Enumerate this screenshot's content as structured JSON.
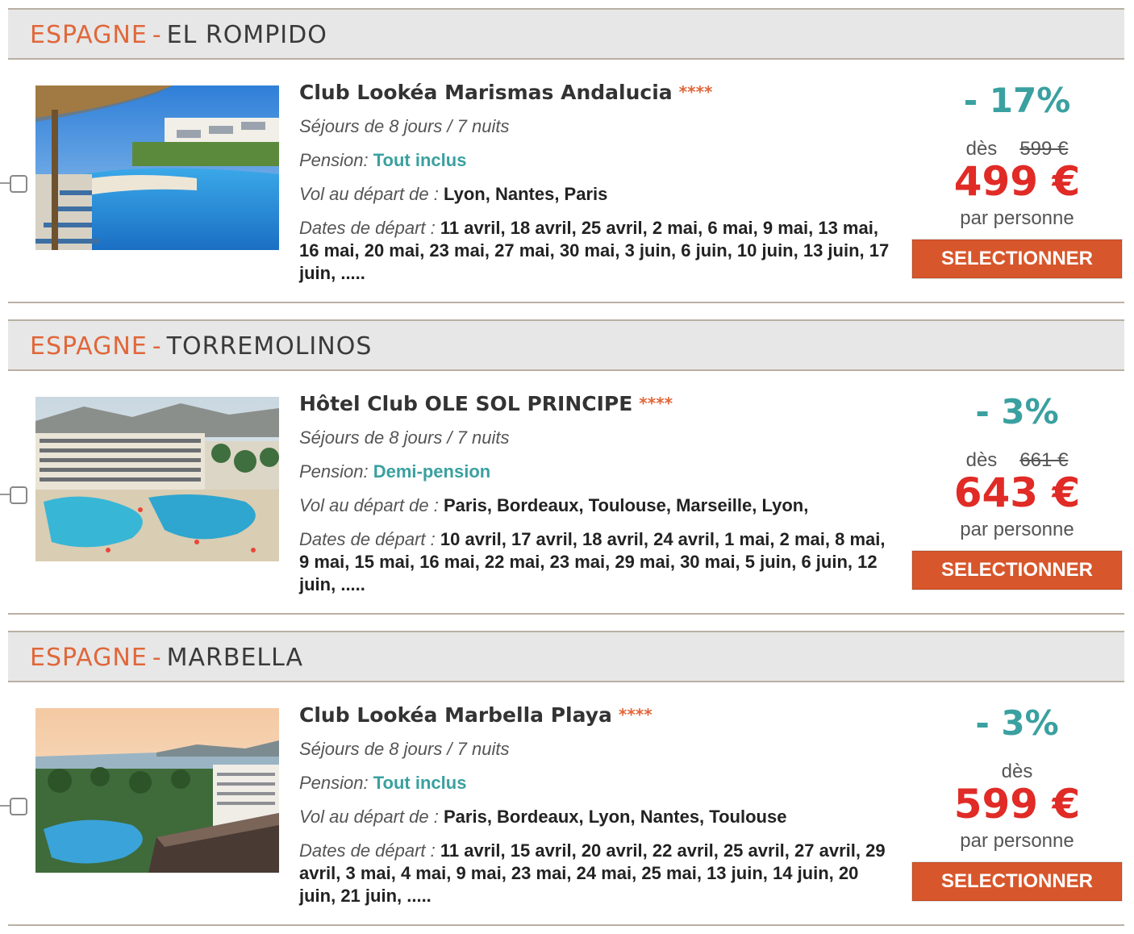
{
  "colors": {
    "accent": "#e0673a",
    "teal": "#3aa0a0",
    "price_red": "#e02b26",
    "button": "#d8562b"
  },
  "listings": [
    {
      "country": "ESPAGNE",
      "separator": "-",
      "city": "EL ROMPIDO",
      "hotel": "Club Lookéa Marismas Andalucia",
      "stars": "****",
      "stay": "Séjours de 8 jours / 7 nuits",
      "pension_label": "Pension:",
      "pension": "Tout inclus",
      "flight_label": "Vol au départ de :",
      "flights": "Lyon, Nantes, Paris",
      "dates_label": "Dates de départ :",
      "dates": "11 avril, 18 avril, 25 avril, 2 mai, 6 mai, 9 mai, 13 mai, 16 mai, 20 mai, 23 mai, 27 mai, 30 mai, 3 juin, 6 juin, 10 juin, 13 juin, 17 juin, .....",
      "discount": "- 17%",
      "from_label": "dès",
      "old_price": "599 €",
      "price": "499 €",
      "per_person": "par personne",
      "button": "SELECTIONNER",
      "image": "pool-resort-umbrella"
    },
    {
      "country": "ESPAGNE",
      "separator": "-",
      "city": "TORREMOLINOS",
      "hotel": "Hôtel Club OLE SOL PRINCIPE",
      "stars": "****",
      "stay": "Séjours de 8 jours / 7 nuits",
      "pension_label": "Pension:",
      "pension": "Demi-pension",
      "flight_label": "Vol au départ de :",
      "flights": "Paris, Bordeaux, Toulouse, Marseille, Lyon,",
      "dates_label": "Dates de départ :",
      "dates": "10 avril, 17 avril, 18 avril, 24 avril, 1 mai, 2 mai, 8 mai, 9 mai, 15 mai, 16 mai, 22 mai, 23 mai, 29 mai, 30 mai, 5 juin, 6 juin, 12 juin, .....",
      "discount": "- 3%",
      "from_label": "dès",
      "old_price": "661 €",
      "price": "643 €",
      "per_person": "par personne",
      "button": "SELECTIONNER",
      "image": "hotel-building-pools"
    },
    {
      "country": "ESPAGNE",
      "separator": "-",
      "city": "MARBELLA",
      "hotel": "Club Lookéa Marbella Playa",
      "stars": "****",
      "stay": "Séjours de 8 jours / 7 nuits",
      "pension_label": "Pension:",
      "pension": "Tout inclus",
      "flight_label": "Vol au départ de :",
      "flights": "Paris, Bordeaux, Lyon, Nantes, Toulouse",
      "dates_label": "Dates de départ :",
      "dates": "11 avril, 15 avril, 20 avril, 22 avril, 25 avril, 27 avril, 29 avril, 3 mai, 4 mai, 9 mai, 23 mai, 24 mai, 25 mai, 13 juin, 14 juin, 20 juin, 21 juin, .....",
      "discount": "- 3%",
      "from_label": "dès",
      "old_price": "",
      "price": "599 €",
      "per_person": "par personne",
      "button": "SELECTIONNER",
      "image": "sunset-coast-resort"
    }
  ]
}
